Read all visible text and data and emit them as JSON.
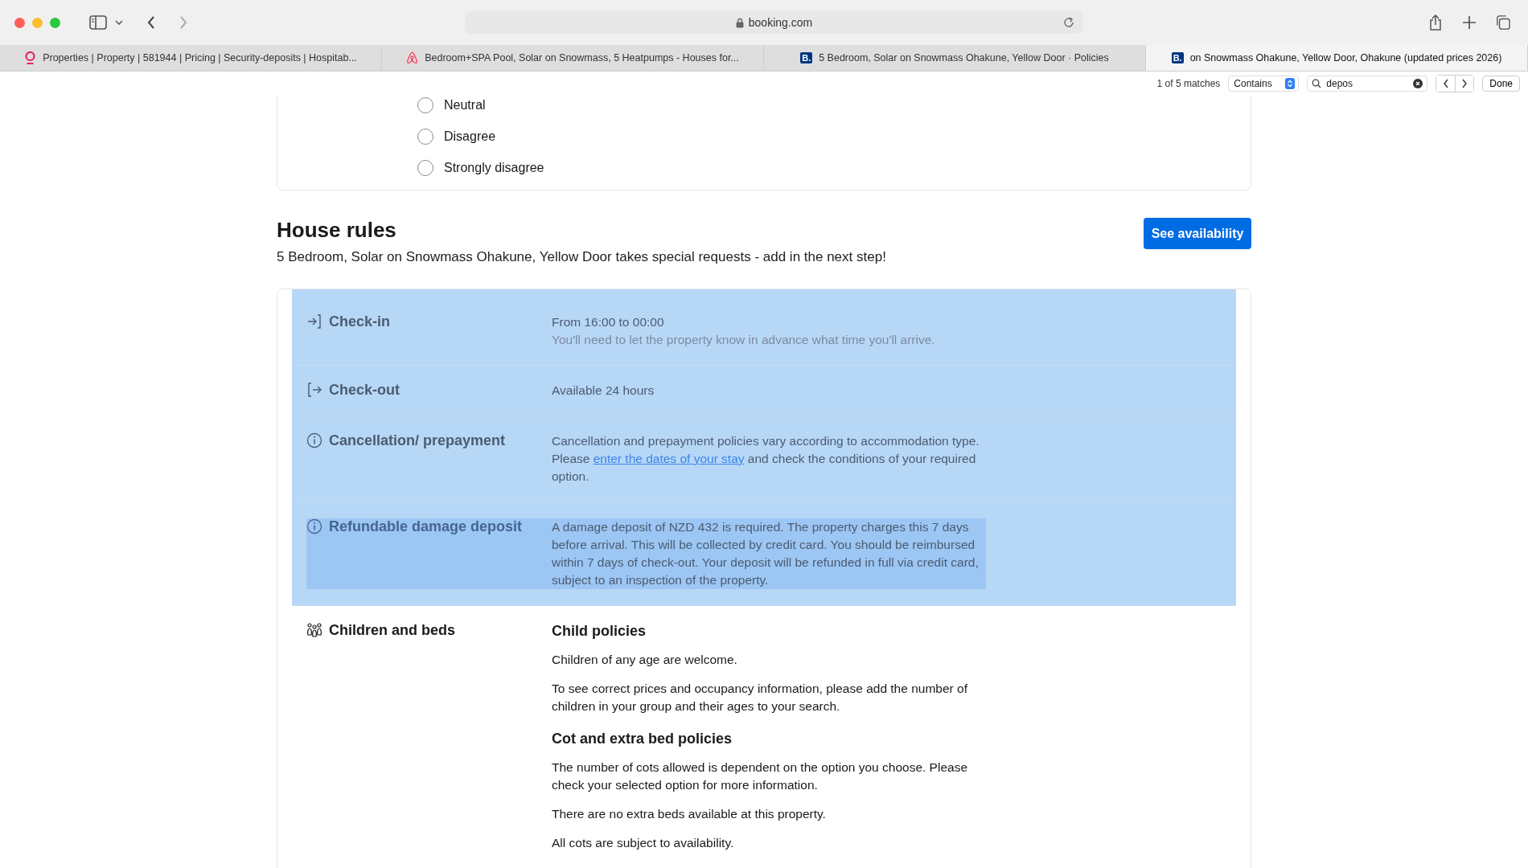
{
  "browser": {
    "address": "booking.com",
    "tabs": [
      {
        "kind": "ring",
        "title": "Properties | Property | 581944 | Pricing | Security-deposits | Hospitab...",
        "selected": false
      },
      {
        "kind": "loop",
        "title": "Bedroom+SPA Pool, Solar on Snowmass, 5 Heatpumps - Houses for...",
        "selected": false
      },
      {
        "kind": "letter",
        "logo": "B.",
        "title": "5 Bedroom, Solar on Snowmass Ohakune, Yellow Door · Policies",
        "selected": false
      },
      {
        "kind": "letter",
        "logo": "B.",
        "title": "on Snowmass Ohakune, Yellow Door, Ohakune (updated prices 2026)",
        "selected": true
      }
    ]
  },
  "find_bar": {
    "matches": "1 of 5 matches",
    "mode": "Contains",
    "query": "depos",
    "done": "Done"
  },
  "survey": {
    "options": [
      {
        "label": "Neutral",
        "selected": false
      },
      {
        "label": "Disagree",
        "selected": false
      },
      {
        "label": "Strongly disagree",
        "selected": false
      }
    ]
  },
  "house_rules": {
    "title": "House rules",
    "subtitle": "5 Bedroom, Solar on Snowmass Ohakune, Yellow Door takes special requests - add in the next step!",
    "button": "See availability",
    "rules": [
      {
        "label": "Check-in",
        "highlighted": true,
        "selected": false,
        "content": [
          {
            "kind": "text",
            "text": "From 16:00 to 00:00"
          },
          {
            "kind": "note",
            "text": "You'll need to let the property know in advance what time you'll arrive."
          }
        ]
      },
      {
        "label": "Check-out",
        "highlighted": true,
        "selected": false,
        "content": [
          {
            "kind": "text",
            "text": "Available 24 hours"
          }
        ]
      },
      {
        "label": "Cancellation/ prepayment",
        "highlighted": true,
        "selected": false,
        "content": [
          {
            "kind": "linked",
            "before": "Cancellation and prepayment policies vary according to accommodation type. Please ",
            "link": "enter the dates of your stay",
            "after": " and check the conditions of your required option."
          }
        ]
      },
      {
        "label": "Refundable damage deposit",
        "highlighted": true,
        "selected": true,
        "content": [
          {
            "kind": "text",
            "text": "A damage deposit of NZD 432 is required. The property charges this 7 days before arrival. This will be collected by credit card. You should be reimbursed within 7 days of check-out. Your deposit will be refunded in full via credit card, subject to an inspection of the property."
          }
        ]
      },
      {
        "label": "Children and beds",
        "highlighted": false,
        "selected": false,
        "content": [
          {
            "kind": "heading",
            "text": "Child policies"
          },
          {
            "kind": "text",
            "text": "Children of any age are welcome."
          },
          {
            "kind": "text",
            "text": "To see correct prices and occupancy information, please add the number of children in your group and their ages to your search."
          },
          {
            "kind": "heading",
            "text": "Cot and extra bed policies"
          },
          {
            "kind": "text",
            "text": "The number of cots allowed is dependent on the option you choose. Please check your selected option for more information."
          },
          {
            "kind": "text",
            "text": "There are no extra beds available at this property."
          },
          {
            "kind": "text",
            "text": "All cots are subject to availability."
          }
        ]
      }
    ]
  }
}
